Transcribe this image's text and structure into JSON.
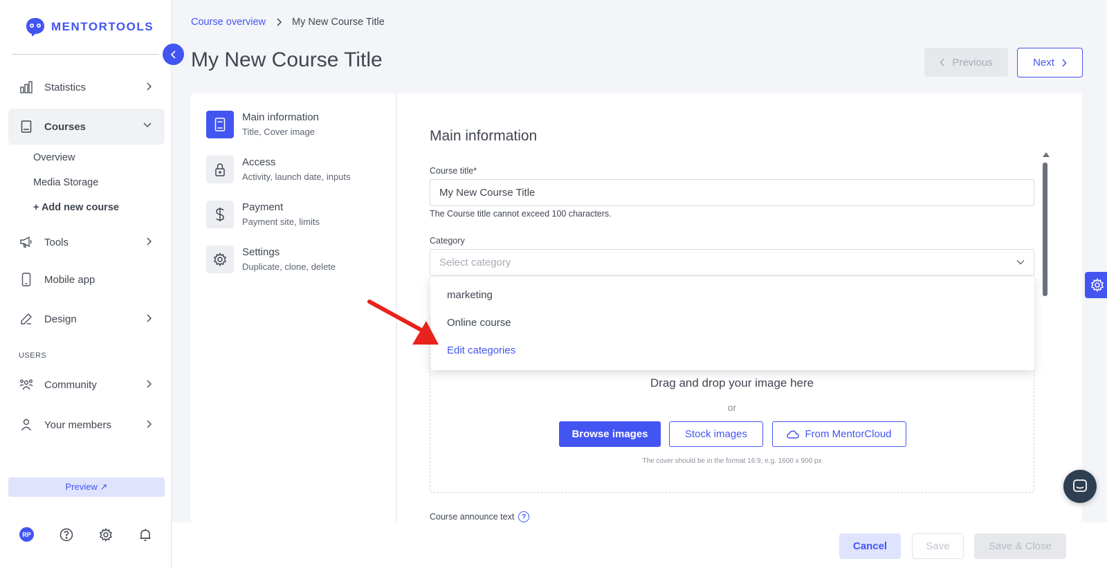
{
  "brand": {
    "name": "MENTORTOOLS",
    "accent": "#4355f0"
  },
  "sidebar": {
    "items": [
      {
        "label": "Statistics",
        "icon": "bar-chart-icon"
      },
      {
        "label": "Courses",
        "icon": "book-icon"
      },
      {
        "label": "Tools",
        "icon": "megaphone-icon"
      },
      {
        "label": "Mobile app",
        "icon": "phone-icon"
      },
      {
        "label": "Design",
        "icon": "pencil-icon"
      },
      {
        "label": "Community",
        "icon": "people-icon"
      },
      {
        "label": "Your members",
        "icon": "person-icon"
      }
    ],
    "courses_sub": [
      "Overview",
      "Media Storage",
      "+ Add new course"
    ],
    "section_users": "USERS",
    "preview_label": "Preview ↗",
    "avatar_initials": "RP"
  },
  "breadcrumb": {
    "parent": "Course overview",
    "current": "My New Course Title"
  },
  "page": {
    "title": "My New Course Title",
    "prev_label": "Previous",
    "next_label": "Next"
  },
  "steps": [
    {
      "title": "Main information",
      "sub": "Title, Cover image",
      "icon": "document-icon"
    },
    {
      "title": "Access",
      "sub": "Activity, launch date, inputs",
      "icon": "lock-icon"
    },
    {
      "title": "Payment",
      "sub": "Payment site, limits",
      "icon": "dollar-icon"
    },
    {
      "title": "Settings",
      "sub": "Duplicate, clone, delete",
      "icon": "gear-icon"
    }
  ],
  "form": {
    "section_title": "Main information",
    "course_title_label": "Course title*",
    "course_title_value": "My New Course Title",
    "course_title_hint": "The Course title cannot exceed 100 characters.",
    "category_label": "Category",
    "category_placeholder": "Select category",
    "category_options": [
      "marketing",
      "Online course",
      "Edit categories"
    ],
    "dropzone_title": "Drag and drop your image here",
    "dropzone_or": "or",
    "browse_label": "Browse images",
    "stock_label": "Stock images",
    "cloud_label": "From MentorCloud",
    "cover_note": "The cover should be in the format 16:9, e.g. 1600 x 900 px",
    "announce_label": "Course announce text"
  },
  "footer": {
    "cancel_label": "Cancel",
    "save_label": "Save",
    "save_close_label": "Save & Close"
  }
}
